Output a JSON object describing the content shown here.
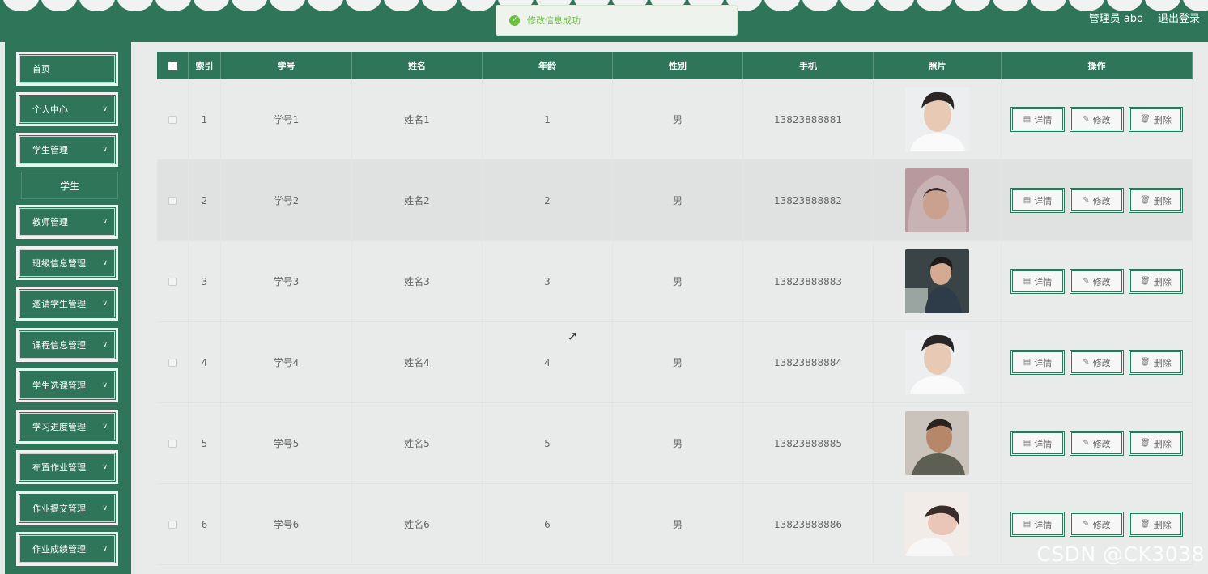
{
  "header": {
    "user_label": "管理员 abo",
    "logout_label": "退出登录"
  },
  "toast": {
    "message": "修改信息成功",
    "icon": "check-circle-icon"
  },
  "sidebar": {
    "items": [
      {
        "label": "首页",
        "expandable": false
      },
      {
        "label": "个人中心",
        "expandable": true
      },
      {
        "label": "学生管理",
        "expandable": true
      },
      {
        "label": "教师管理",
        "expandable": true
      },
      {
        "label": "班级信息管理",
        "expandable": true
      },
      {
        "label": "邀请学生管理",
        "expandable": true
      },
      {
        "label": "课程信息管理",
        "expandable": true
      },
      {
        "label": "学生选课管理",
        "expandable": true
      },
      {
        "label": "学习进度管理",
        "expandable": true
      },
      {
        "label": "布置作业管理",
        "expandable": true
      },
      {
        "label": "作业提交管理",
        "expandable": true
      },
      {
        "label": "作业成绩管理",
        "expandable": true
      }
    ],
    "sub_item": {
      "label": "学生"
    }
  },
  "table": {
    "headers": {
      "index": "索引",
      "student_no": "学号",
      "name": "姓名",
      "age": "年龄",
      "gender": "性别",
      "phone": "手机",
      "photo": "照片",
      "actions": "操作"
    },
    "rows": [
      {
        "index": "1",
        "student_no": "学号1",
        "name": "姓名1",
        "age": "1",
        "gender": "男",
        "phone": "13823888881"
      },
      {
        "index": "2",
        "student_no": "学号2",
        "name": "姓名2",
        "age": "2",
        "gender": "男",
        "phone": "13823888882"
      },
      {
        "index": "3",
        "student_no": "学号3",
        "name": "姓名3",
        "age": "3",
        "gender": "男",
        "phone": "13823888883"
      },
      {
        "index": "4",
        "student_no": "学号4",
        "name": "姓名4",
        "age": "4",
        "gender": "男",
        "phone": "13823888884"
      },
      {
        "index": "5",
        "student_no": "学号5",
        "name": "姓名5",
        "age": "5",
        "gender": "男",
        "phone": "13823888885"
      },
      {
        "index": "6",
        "student_no": "学号6",
        "name": "姓名6",
        "age": "6",
        "gender": "男",
        "phone": "13823888886"
      }
    ],
    "actions": {
      "detail": "详情",
      "edit": "修改",
      "delete": "删除"
    }
  },
  "watermark": "CSDN @CK3038",
  "colors": {
    "primary": "#2e7559",
    "success": "#67c23a",
    "background": "#e9ebea"
  }
}
